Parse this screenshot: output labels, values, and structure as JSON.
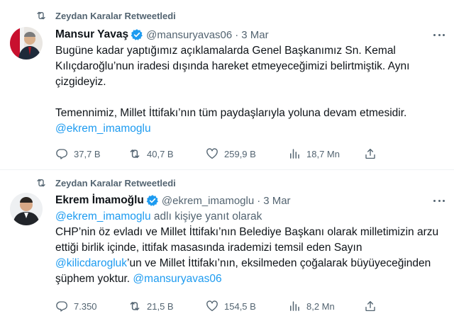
{
  "tweets": [
    {
      "retweet_label": "Zeydan Karalar Retweetledi",
      "author_name": "Mansur Yavaş",
      "handle": "@mansuryavas06",
      "separator": "·",
      "date": "3 Mar",
      "paragraph1": "Bugüne kadar yaptığımız açıklamalarda Genel Başkanımız Sn. Kemal Kılıçdaroğlu’nun iradesi dışında hareket etmeyeceğimizi belirtmiştik. Aynı çizgideyiz.",
      "paragraph2": "Temennimiz, Millet İttifakı’nın tüm paydaşlarıyla yoluna devam etmesidir.",
      "mention": "@ekrem_imamoglu",
      "stats": {
        "replies": "37,7 B",
        "retweets": "40,7 B",
        "likes": "259,9 B",
        "views": "18,7 Mn"
      }
    },
    {
      "retweet_label": "Zeydan Karalar Retweetledi",
      "author_name": "Ekrem İmamoğlu",
      "handle": "@ekrem_imamoglu",
      "separator": "·",
      "date": "3 Mar",
      "reply_to_mention": "@ekrem_imamoglu",
      "reply_to_suffix": " adlı kişiye yanıt olarak",
      "text_part1": "CHP’nin öz evladı ve Millet İttifakı’nın Belediye Başkanı olarak milletimizin arzu ettiği birlik içinde, ittifak masasında irademizi temsil eden Sayın ",
      "mention1": "@kilicdarogluk",
      "text_part2": "’un ve Millet İttifakı’nın, eksilmeden çoğalarak büyüyeceğinden şüphem yoktur. ",
      "mention2": "@mansuryavas06",
      "stats": {
        "replies": "7.350",
        "retweets": "21,5 B",
        "likes": "154,5 B",
        "views": "8,2 Mn"
      }
    }
  ],
  "colors": {
    "link": "#1d9bf0",
    "muted": "#536471",
    "text": "#0f1419",
    "verified": "#1d9bf0"
  },
  "icons": [
    "retweet-icon",
    "verified-badge-icon",
    "more-icon",
    "reply-icon",
    "retweet-icon",
    "like-icon",
    "views-icon",
    "share-icon"
  ]
}
